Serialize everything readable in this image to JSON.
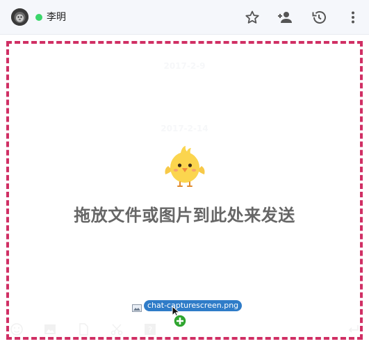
{
  "header": {
    "contact_name": "李明",
    "status_color": "#3bd66b",
    "icons": [
      "star-icon",
      "add-person-icon",
      "history-icon",
      "more-vertical-icon"
    ]
  },
  "chat": {
    "dates": [
      "2017-2-9",
      "2017-2-14"
    ]
  },
  "drop_overlay": {
    "message": "拖放文件或图片到此处来发送",
    "border_color": "#d02f64"
  },
  "dragged_file": {
    "name": "chat-capturescreen.png",
    "pill_color": "#2f7cc8"
  },
  "toolbar": {
    "icons": [
      "emoji-icon",
      "image-icon",
      "file-icon",
      "scissors-icon",
      "help-icon",
      "send-enter-icon"
    ]
  }
}
